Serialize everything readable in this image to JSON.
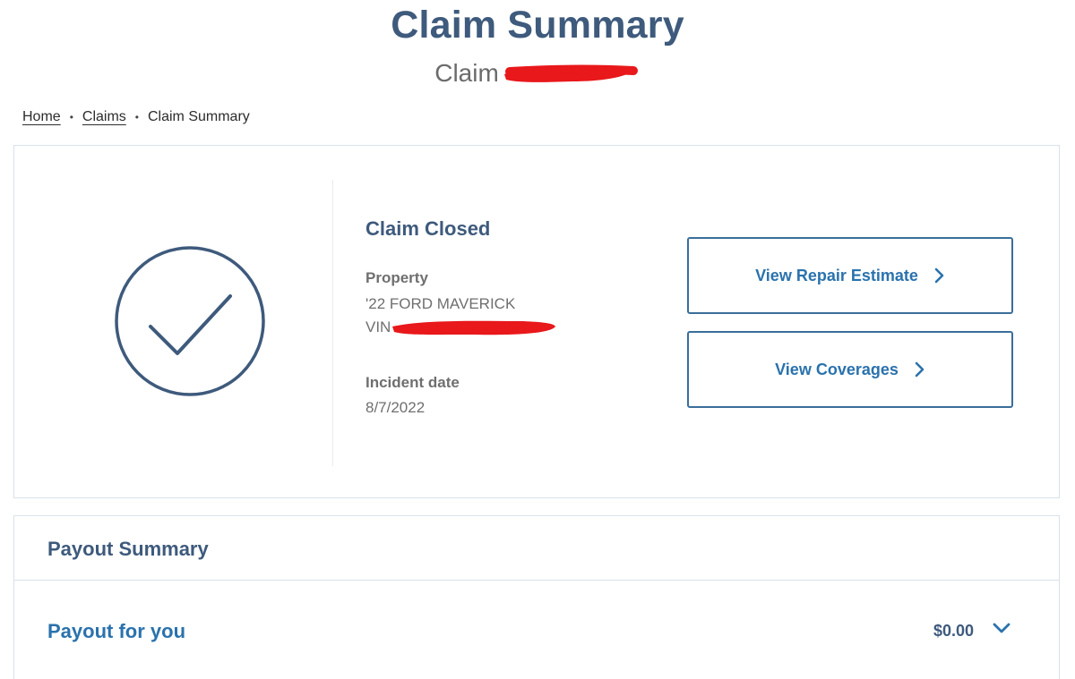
{
  "header": {
    "title": "Claim Summary",
    "subtitle_prefix": "Claim"
  },
  "breadcrumb": {
    "items": [
      {
        "label": "Home"
      },
      {
        "label": "Claims"
      },
      {
        "label": "Claim Summary"
      }
    ]
  },
  "claim": {
    "status": "Claim Closed",
    "status_icon": "check-circle-icon",
    "property_label": "Property",
    "vehicle": "'22 FORD MAVERICK",
    "vin_label": "VIN",
    "incident_label": "Incident date",
    "incident_date": "8/7/2022"
  },
  "actions": {
    "repair_estimate": "View Repair Estimate",
    "coverages": "View Coverages",
    "chevron_icon": "chevron-right-icon"
  },
  "payout": {
    "section_title": "Payout Summary",
    "row_label": "Payout for you",
    "amount": "$0.00",
    "toggle_icon": "chevron-down-icon"
  },
  "colors": {
    "heading": "#3e5a7c",
    "link_blue": "#2a72ad",
    "redaction": "#e8181b",
    "border": "#d9e2ea"
  }
}
